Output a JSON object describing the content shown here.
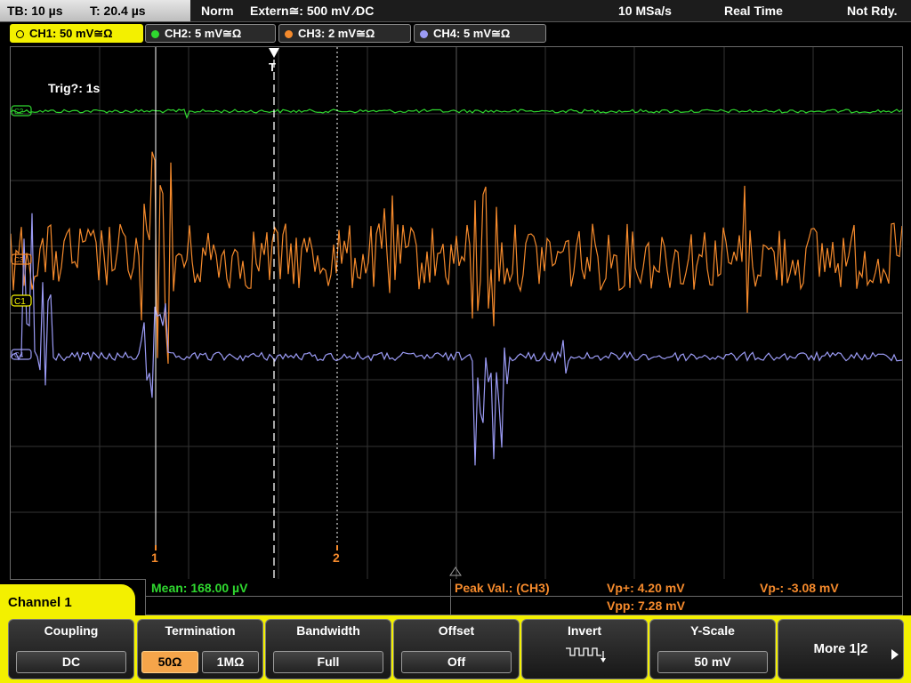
{
  "status_bar": {
    "timebase": "TB: 10 µs",
    "trigger_time": "T: 20.4 µs",
    "trigger_mode": "Norm",
    "trigger_source": "Extern≅: 500 mV ⁄DC",
    "sample_rate": "10 MSa/s",
    "acquisition": "Real Time",
    "status": "Not Rdy."
  },
  "channels": [
    {
      "label": "CH1: 50 mV≅Ω",
      "color": "#f3f000",
      "active": true
    },
    {
      "label": "CH2: 5 mV≅Ω",
      "color": "#2fd82f",
      "active": false
    },
    {
      "label": "CH3: 2 mV≅Ω",
      "color": "#f58a2c",
      "active": false
    },
    {
      "label": "CH4: 5 mV≅Ω",
      "color": "#9b9bf5",
      "active": false
    }
  ],
  "screen": {
    "trigger_info": "Trig?: 1s",
    "trigger_marker": "T",
    "cursor1_label": "1",
    "cursor2_label": "2",
    "ch1_marker": "C1",
    "channel_markers": {
      "ch2": "C2",
      "ch3": "C3",
      "ch4": "C4"
    }
  },
  "measurements": {
    "mean": "Mean: 168.00 µV",
    "peak_title": "Peak Val.:  (CH3)",
    "vp_plus": "Vp+: 4.20 mV",
    "vp_minus": "Vp-: -3.08 mV",
    "vpp": "Vpp: 7.28 mV"
  },
  "menu": {
    "title": "Channel 1",
    "coupling": {
      "title": "Coupling",
      "value": "DC"
    },
    "termination": {
      "title": "Termination",
      "option1": "50Ω",
      "option2": "1MΩ",
      "selected": "50Ω"
    },
    "bandwidth": {
      "title": "Bandwidth",
      "value": "Full"
    },
    "offset": {
      "title": "Offset",
      "value": "Off"
    },
    "invert": {
      "title": "Invert"
    },
    "yscale": {
      "title": "Y-Scale",
      "value": "50 mV"
    },
    "more": "More 1|2"
  }
}
